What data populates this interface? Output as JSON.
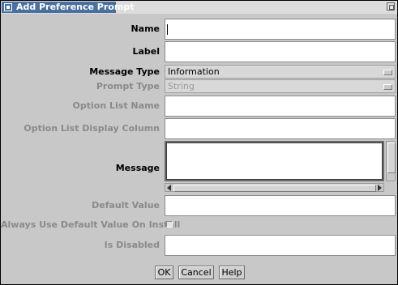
{
  "window": {
    "title": "Add Preference Prompt"
  },
  "form": {
    "name_label": "Name",
    "name_value": "",
    "label_label": "Label",
    "label_value": "",
    "message_type_label": "Message Type",
    "message_type_value": "Information",
    "prompt_type_label": "Prompt Type",
    "prompt_type_value": "String",
    "option_list_name_label": "Option List Name",
    "option_list_name_value": "",
    "option_list_display_column_label": "Option List Display Column",
    "option_list_display_column_value": "",
    "message_label": "Message",
    "message_value": "",
    "default_value_label": "Default Value",
    "default_value_value": "",
    "always_use_default_label": "Always Use Default Value On Install",
    "always_use_default_checked": false,
    "is_disabled_label": "Is Disabled",
    "is_disabled_value": ""
  },
  "buttons": {
    "ok_label": "OK",
    "cancel_label": "Cancel",
    "help_label": "Help"
  }
}
